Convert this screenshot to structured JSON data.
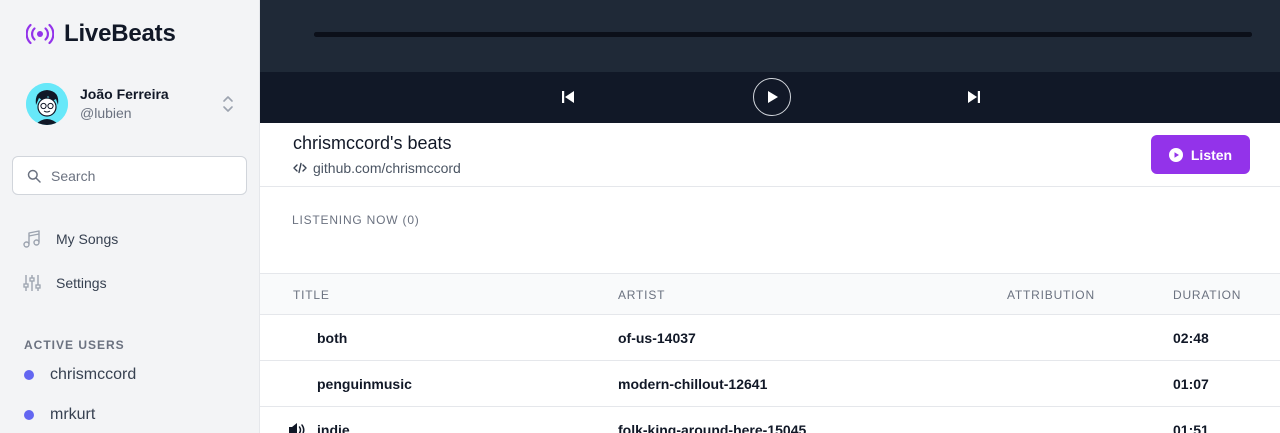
{
  "app": {
    "name": "LiveBeats",
    "accent": "#9333ea"
  },
  "user": {
    "name": "João Ferreira",
    "handle": "@lubien"
  },
  "search": {
    "placeholder": "Search",
    "value": ""
  },
  "nav": {
    "items": [
      {
        "label": "My Songs",
        "icon": "music-note-icon"
      },
      {
        "label": "Settings",
        "icon": "sliders-icon"
      }
    ]
  },
  "active_users": {
    "title": "ACTIVE USERS",
    "items": [
      "chrismccord",
      "mrkurt"
    ]
  },
  "profile": {
    "title": "chrismccord's beats",
    "github": "github.com/chrismccord",
    "listen_label": "Listen"
  },
  "listening_now": "LISTENING NOW (0)",
  "table": {
    "headers": [
      "TITLE",
      "ARTIST",
      "ATTRIBUTION",
      "DURATION"
    ],
    "rows": [
      {
        "title": "both",
        "artist": "of-us-14037",
        "attribution": "",
        "duration": "02:48",
        "playing": false
      },
      {
        "title": "penguinmusic",
        "artist": "modern-chillout-12641",
        "attribution": "",
        "duration": "01:07",
        "playing": false
      },
      {
        "title": "indie",
        "artist": "folk-king-around-here-15045",
        "attribution": "",
        "duration": "01:51",
        "playing": true
      }
    ]
  }
}
